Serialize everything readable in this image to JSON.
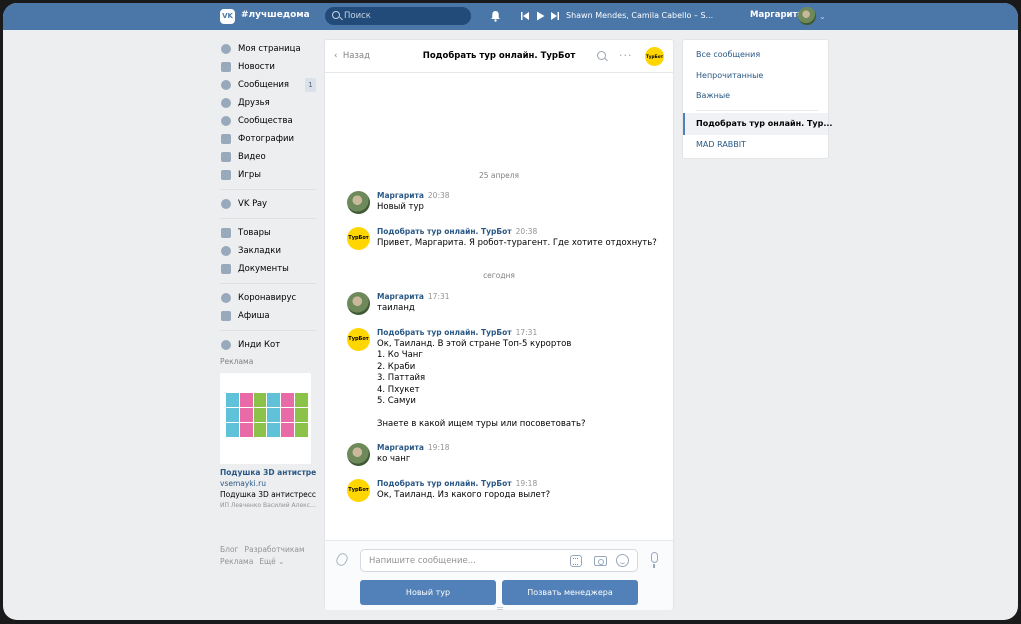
{
  "topbar": {
    "logo": "VK",
    "hashtag": "#лучшедома",
    "search_placeholder": "Поиск",
    "track": "Shawn Mendes, Camila Cabello – S...",
    "user_name": "Маргарита"
  },
  "left_nav": {
    "items": [
      {
        "label": "Моя страница"
      },
      {
        "label": "Новости"
      },
      {
        "label": "Сообщения",
        "badge": "1"
      },
      {
        "label": "Друзья"
      },
      {
        "label": "Сообщества"
      },
      {
        "label": "Фотографии"
      },
      {
        "label": "Видео"
      },
      {
        "label": "Игры"
      }
    ],
    "items2": [
      {
        "label": "VK Pay"
      }
    ],
    "items3": [
      {
        "label": "Товары"
      },
      {
        "label": "Закладки"
      },
      {
        "label": "Документы"
      }
    ],
    "items4": [
      {
        "label": "Коронавирус"
      },
      {
        "label": "Афиша"
      }
    ],
    "items5": [
      {
        "label": "Инди Кот"
      }
    ],
    "ad": {
      "heading": "Реклама",
      "title": "Подушка 3D антистресс ...",
      "domain": "vsemayki.ru",
      "text": "Подушка 3D антистресс",
      "legal": "ИП Левченко Василий Алекс..."
    },
    "footer": {
      "blog": "Блог",
      "developers": "Разработчикам",
      "ads": "Реклама",
      "more": "Ещё ⌄"
    }
  },
  "chat": {
    "back_label": "Назад",
    "title": "Подобрать тур онлайн. ТурБот",
    "bot_avatar_text": "ТурБот",
    "date_seps": [
      "25 апреля",
      "сегодня"
    ],
    "messages": [
      {
        "name": "Маргарита",
        "time": "20:38",
        "text": "Новый тур",
        "avatar": "user"
      },
      {
        "name": "Подобрать тур онлайн. ТурБот",
        "time": "20:38",
        "text": "Привет, Маргарита. Я робот-турагент. Где хотите отдохнуть?",
        "avatar": "bot"
      },
      {
        "name": "Маргарита",
        "time": "17:31",
        "text": "таиланд",
        "avatar": "user"
      },
      {
        "name": "Подобрать тур онлайн. ТурБот",
        "time": "17:31",
        "text": "Ок, Таиланд. В этой стране Топ-5 курортов\n1. Ко Чанг\n2. Краби\n3. Паттайя\n4. Пхукет\n5. Самуи\n\nЗнаете в какой ищем туры или посоветовать?",
        "avatar": "bot"
      },
      {
        "name": "Маргарита",
        "time": "19:18",
        "text": "ко чанг",
        "avatar": "user"
      },
      {
        "name": "Подобрать тур онлайн. ТурБот",
        "time": "19:18",
        "text": "Ок, Таиланд. Из какого города вылет?",
        "avatar": "bot"
      }
    ],
    "input_placeholder": "Напишите сообщение...",
    "buttons": [
      "Новый тур",
      "Позвать менеджера"
    ]
  },
  "right_nav": {
    "filters": [
      "Все сообщения",
      "Непрочитанные",
      "Важные"
    ],
    "conversations": [
      "Подобрать тур онлайн. Тур...",
      "MAD RABBIT"
    ]
  },
  "colors": {
    "brand": "#4a76a8",
    "button": "#5181b8",
    "link": "#2a5885",
    "bot_avatar": "#ffd600"
  }
}
